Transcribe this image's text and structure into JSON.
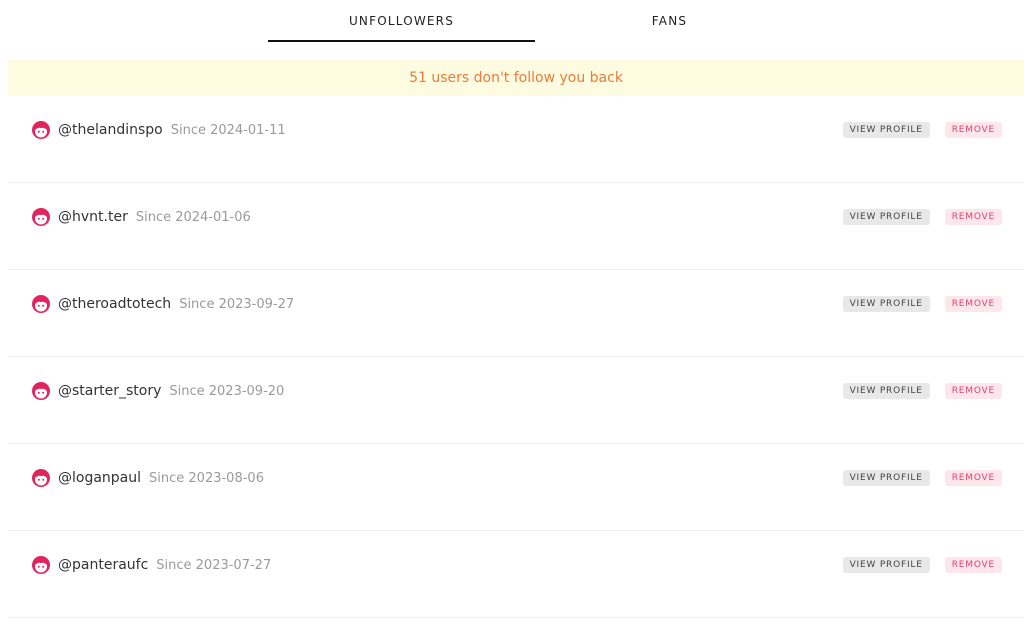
{
  "tabs": [
    {
      "label": "UNFOLLOWERS",
      "active": true
    },
    {
      "label": "FANS",
      "active": false
    }
  ],
  "banner": {
    "text": "51 users don't follow you back",
    "color": "#e97c3c",
    "background": "#fefce0"
  },
  "buttons": {
    "view_profile_label": "VIEW PROFILE",
    "remove_label": "REMOVE"
  },
  "colors": {
    "avatar": "#e0245e",
    "remove_text": "#e2426d",
    "remove_bg": "#fde6ec",
    "view_bg": "#e8e8e8"
  },
  "users": [
    {
      "username": "@thelandinspo",
      "since": "Since 2024-01-11"
    },
    {
      "username": "@hvnt.ter",
      "since": "Since 2024-01-06"
    },
    {
      "username": "@theroadtotech",
      "since": "Since 2023-09-27"
    },
    {
      "username": "@starter_story",
      "since": "Since 2023-09-20"
    },
    {
      "username": "@loganpaul",
      "since": "Since 2023-08-06"
    },
    {
      "username": "@panteraufc",
      "since": "Since 2023-07-27"
    }
  ]
}
